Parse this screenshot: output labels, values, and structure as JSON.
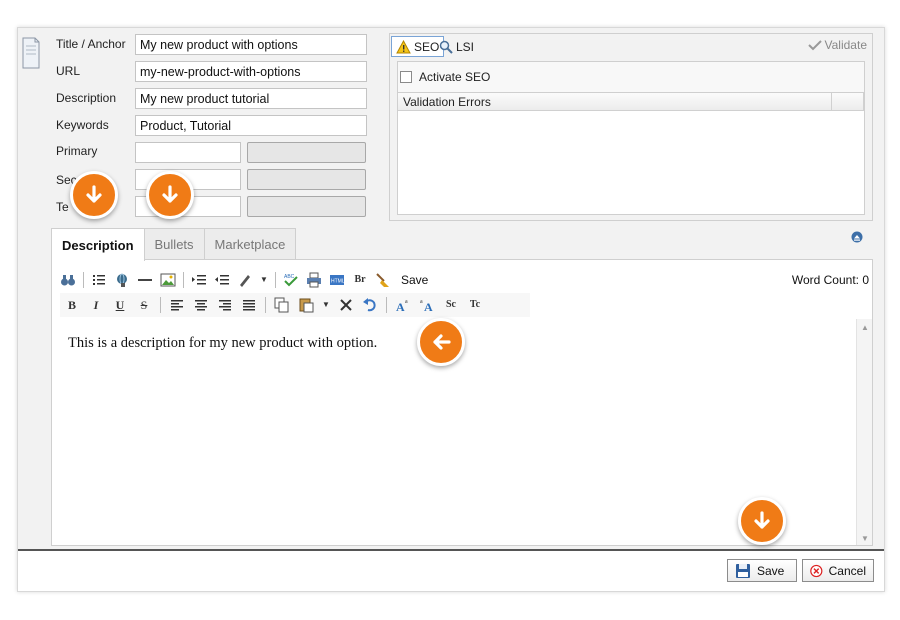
{
  "form": {
    "title_label": "Title / Anchor",
    "title_value": "My new product with options",
    "url_label": "URL",
    "url_value": "my-new-product-with-options",
    "description_label": "Description",
    "description_value": "My new product tutorial",
    "keywords_label": "Keywords",
    "keywords_value": "Product, Tutorial",
    "primary_label": "Primary",
    "secondary_label": "Sec",
    "tertiary_label": "Te"
  },
  "seo": {
    "seo_tab": "SEO",
    "lsi_tab": "LSI",
    "validate": "Validate",
    "activate_label": "Activate SEO",
    "validation_header": "Validation Errors"
  },
  "tabs": [
    "Description",
    "Bullets",
    "Marketplace"
  ],
  "editor": {
    "save_label": "Save",
    "word_count": "Word Count: 0",
    "content": "This is a description for my new product with option.",
    "format_buttons": [
      "B",
      "I",
      "U",
      "S"
    ],
    "br_label": "Br",
    "sc_label": "Sc",
    "tc_label": "Tc"
  },
  "footer": {
    "save": "Save",
    "cancel": "Cancel"
  },
  "icons": [
    "document-icon",
    "warning-icon",
    "magnifier-icon",
    "check-icon",
    "binoculars-icon",
    "list-icon",
    "link-icon",
    "rule-icon",
    "image-icon",
    "indent-icon",
    "outdent-icon",
    "pen-icon",
    "spellcheck-icon",
    "print-icon",
    "html-icon",
    "broom-icon",
    "align-left-icon",
    "align-center-icon",
    "align-right-icon",
    "justify-icon",
    "copy-icon",
    "paste-icon",
    "cut-icon",
    "undo-icon",
    "font-larger-icon",
    "font-smaller-icon",
    "floppy-icon",
    "cancel-icon",
    "arrow-down-icon",
    "arrow-left-icon"
  ],
  "colors": {
    "accent": "#f07b16",
    "seo_border": "#7aa4d6"
  }
}
